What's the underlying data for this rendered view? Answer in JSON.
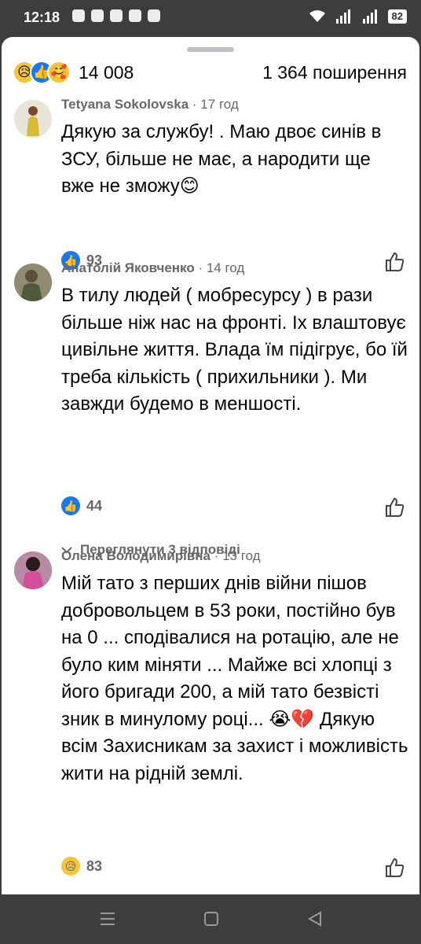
{
  "status": {
    "time": "12:18",
    "battery": "82"
  },
  "summary": {
    "reaction_count": "14 008",
    "shares": "1 364 поширення"
  },
  "comments": [
    {
      "author": "Tetyana Sokolovska",
      "time": " · 17 год",
      "text": "Дякую за службу! . Маю двоє синів в ЗСУ, більше не має, а народити ще вже не зможу😊",
      "reaction": "like",
      "reaction_count": "93"
    },
    {
      "author": "Анатолій Яковченко",
      "time": " · 14 год",
      "text": "В тилу людей  ( мобресурсу ) в рази більше ніж нас на фронті. Іх влаштовує цивільне життя. Влада їм підігрує,  бо їй треба кількість  ( прихильники ). Ми завжди будемо в меншості.",
      "reaction": "like",
      "reaction_count": "44",
      "replies": "Переглянути 3 відповіді"
    },
    {
      "author": "Олена Володимирівна",
      "time": " · 13 год",
      "text": "Мій тато з перших днів війни пішов добровольцем в  53 роки, постійно був на 0 ... сподівалися на ротацію, але не було ким міняти ... Майже всі хлопці з його бригади 200, а мій тато безвісті зник в минулому році...  😭💔 Дякую всім Захисникам за захист і можливість жити на рідній землі.",
      "reaction": "sad",
      "reaction_count": "83"
    }
  ],
  "colors": {
    "like_blue": "#1877f2",
    "secondary_text": "#65676b",
    "primary_text": "#050505"
  }
}
